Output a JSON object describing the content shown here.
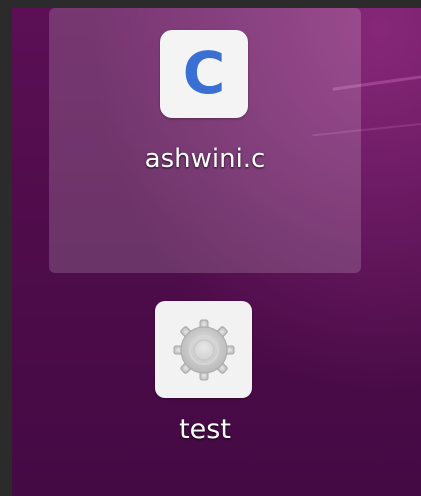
{
  "desktop": {
    "background_colors": [
      "#5c0f55",
      "#440a44"
    ],
    "selection_color": "#ffffff",
    "icons": [
      {
        "label": "ashwini.c",
        "icon": "c-source-file-icon",
        "glyph": "C",
        "glyph_color": "#3a6fd3",
        "selected": true
      },
      {
        "label": "test",
        "icon": "executable-gear-icon",
        "selected": false
      }
    ]
  }
}
